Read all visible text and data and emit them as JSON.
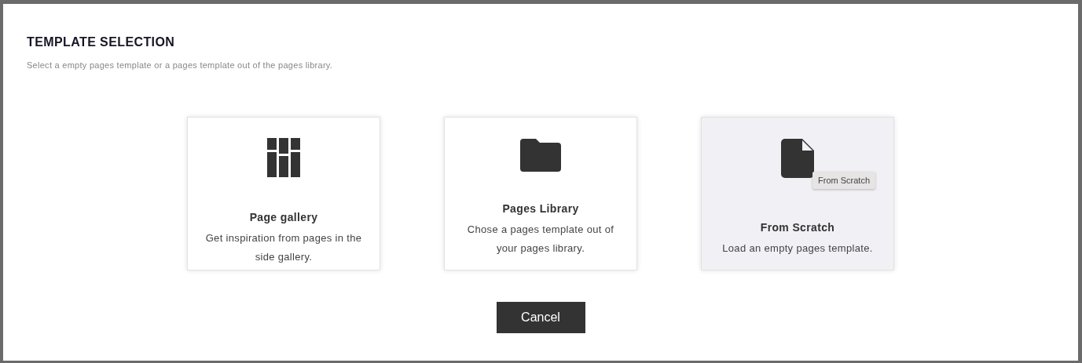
{
  "title": "TEMPLATE SELECTION",
  "subtitle": "Select a empty pages template or a pages template out of the pages library.",
  "cards": [
    {
      "kind": "gallery",
      "title": "Page gallery",
      "description": "Get inspiration from pages in the side gallery.",
      "hovered": false
    },
    {
      "kind": "library",
      "title": "Pages Library",
      "description": "Chose a pages template out of your pages library.",
      "hovered": false
    },
    {
      "kind": "scratch",
      "title": "From Scratch",
      "description": "Load an empty pages template.",
      "hovered": true,
      "tooltip": "From Scratch"
    }
  ],
  "cancel_button": "Cancel"
}
